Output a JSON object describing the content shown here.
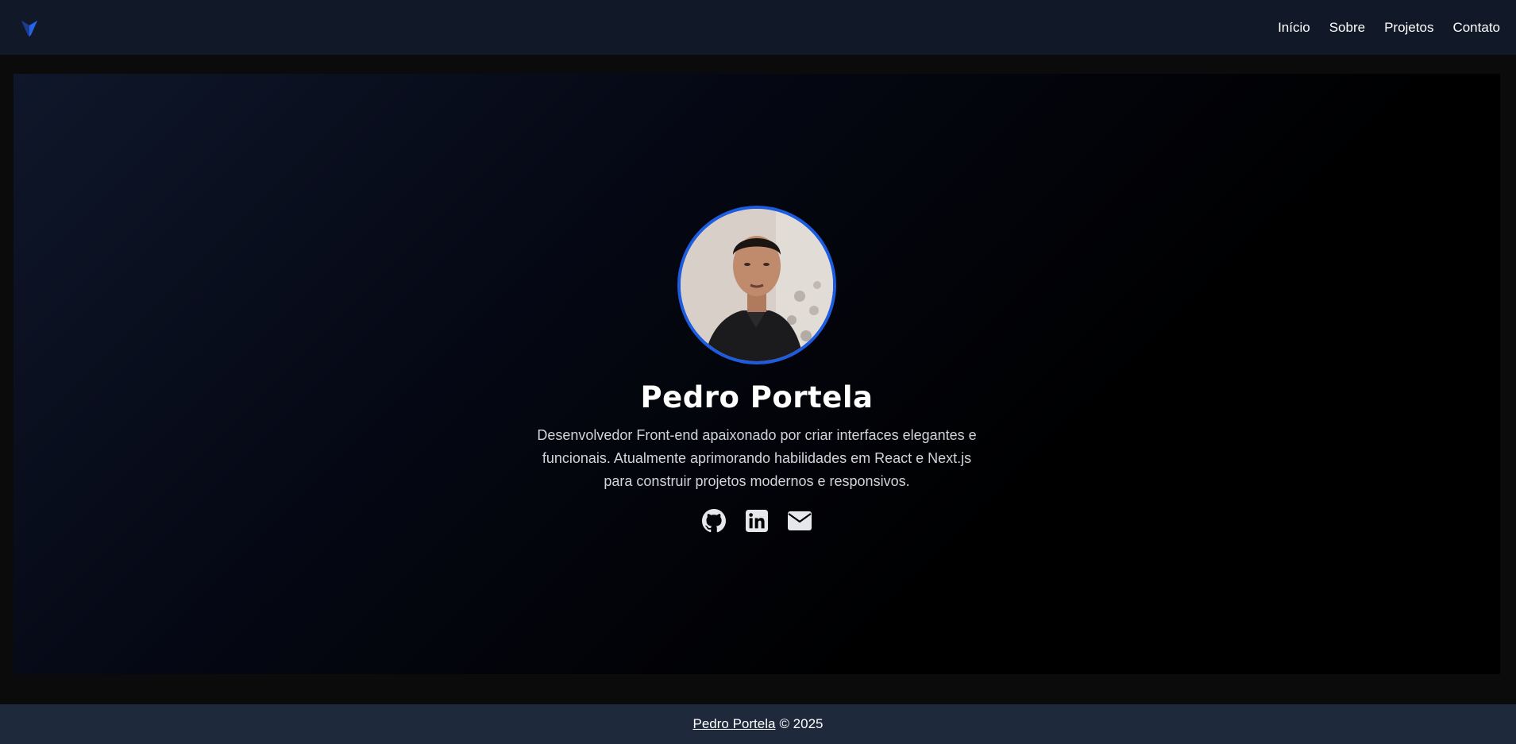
{
  "nav": {
    "logo_icon": "v-wing-logo-icon",
    "links": [
      {
        "label": "Início"
      },
      {
        "label": "Sobre"
      },
      {
        "label": "Projetos"
      },
      {
        "label": "Contato"
      }
    ]
  },
  "hero": {
    "name": "Pedro Portela",
    "bio": "Desenvolvedor Front-end apaixonado por criar interfaces elegantes e funcionais. Atualmente aprimorando habilidades em React e Next.js para construir projetos modernos e responsivos.",
    "socials": [
      {
        "icon": "github-icon"
      },
      {
        "icon": "linkedin-icon"
      },
      {
        "icon": "envelope-icon"
      }
    ]
  },
  "footer": {
    "author": "Pedro Portela",
    "copyright": "© 2025"
  },
  "colors": {
    "navbar_bg": "#111827",
    "footer_bg": "#1e293b",
    "accent_ring": "#1d5ce0",
    "page_bg": "#0b0b0b"
  }
}
